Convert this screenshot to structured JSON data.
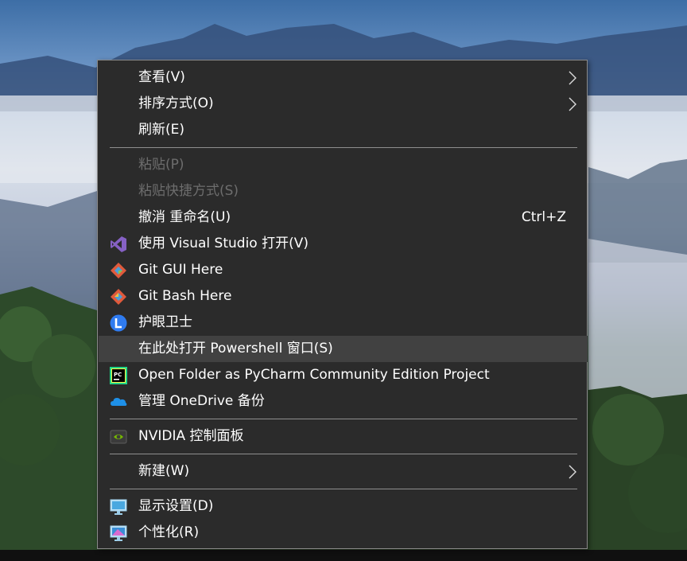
{
  "context_menu": {
    "items": [
      {
        "label": "查看(V)"
      },
      {
        "label": "排序方式(O)"
      },
      {
        "label": "刷新(E)"
      },
      {
        "label": "粘贴(P)"
      },
      {
        "label": "粘贴快捷方式(S)"
      },
      {
        "label": "撤消 重命名(U)",
        "shortcut": "Ctrl+Z"
      },
      {
        "label": "使用 Visual Studio 打开(V)",
        "icon": "visual-studio-icon"
      },
      {
        "label": "Git GUI Here",
        "icon": "git-gui-icon"
      },
      {
        "label": "Git Bash Here",
        "icon": "git-bash-icon"
      },
      {
        "label": "护眼卫士",
        "icon": "eye-guard-icon"
      },
      {
        "label": "在此处打开 Powershell 窗口(S)"
      },
      {
        "label": "Open Folder as PyCharm Community Edition Project",
        "icon": "pycharm-icon"
      },
      {
        "label": "管理 OneDrive 备份",
        "icon": "onedrive-icon"
      },
      {
        "label": "NVIDIA 控制面板",
        "icon": "nvidia-icon"
      },
      {
        "label": "新建(W)"
      },
      {
        "label": "显示设置(D)",
        "icon": "display-settings-icon"
      },
      {
        "label": "个性化(R)",
        "icon": "personalize-icon"
      }
    ]
  },
  "colors": {
    "menu_background": "#2b2b2b",
    "menu_hover": "#414141",
    "text": "#ffffff",
    "text_disabled": "#6d6d6d",
    "separator": "#8f8f8f"
  }
}
